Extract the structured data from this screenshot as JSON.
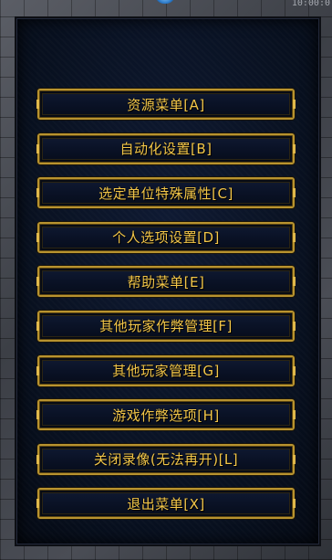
{
  "header": {
    "corner_text": "10:00:0"
  },
  "menu": {
    "items": [
      {
        "label": "资源菜单[A]"
      },
      {
        "label": "自动化设置[B]"
      },
      {
        "label": "选定单位特殊属性[C]"
      },
      {
        "label": "个人选项设置[D]"
      },
      {
        "label": "帮助菜单[E]"
      },
      {
        "label": "其他玩家作弊管理[F]"
      },
      {
        "label": "其他玩家管理[G]"
      },
      {
        "label": "游戏作弊选项[H]"
      },
      {
        "label": "关闭录像(无法再开)[L]"
      },
      {
        "label": "退出菜单[X]"
      }
    ]
  },
  "colors": {
    "accent": "#f2c64a",
    "border_gold": "#b8932f",
    "panel_bg": "#08101f"
  }
}
